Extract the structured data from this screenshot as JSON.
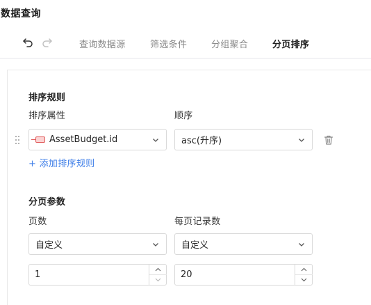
{
  "page": {
    "title": "数据查询"
  },
  "toolbar": {
    "undo_icon": "undo-icon",
    "redo_icon": "redo-icon",
    "tabs": [
      {
        "label": "查询数据源",
        "active": false
      },
      {
        "label": "筛选条件",
        "active": false
      },
      {
        "label": "分组聚合",
        "active": false
      },
      {
        "label": "分页排序",
        "active": true
      }
    ]
  },
  "sort": {
    "title": "排序规则",
    "attr_label": "排序属性",
    "order_label": "顺序",
    "rules": [
      {
        "attribute": "AssetBudget.id",
        "order": "asc(升序)"
      }
    ],
    "add_label": "+ 添加排序规则"
  },
  "paging": {
    "title": "分页参数",
    "page_label": "页数",
    "size_label": "每页记录数",
    "page_mode": "自定义",
    "size_mode": "自定义",
    "page_value": "1",
    "size_value": "20"
  },
  "colors": {
    "accent": "#3e7ee8",
    "field_tag": "#e05a5a",
    "border": "#d9d9d9"
  }
}
